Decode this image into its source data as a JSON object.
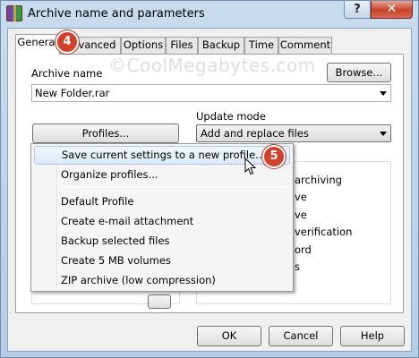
{
  "window": {
    "title": "Archive name and parameters",
    "help_label": "?",
    "close_label": "✕"
  },
  "tabs": [
    {
      "label": "General"
    },
    {
      "label": "Advanced"
    },
    {
      "label": "Options"
    },
    {
      "label": "Files"
    },
    {
      "label": "Backup"
    },
    {
      "label": "Time"
    },
    {
      "label": "Comment"
    }
  ],
  "general": {
    "archive_name_label": "Archive name",
    "archive_name_value": "New Folder.rar",
    "browse_label": "Browse...",
    "profiles_label": "Profiles...",
    "update_mode_label": "Update mode",
    "update_mode_value": "Add and replace files",
    "options_partial": [
      "archiving",
      "ve",
      "ve",
      "verification",
      "ord",
      "s"
    ]
  },
  "menu": {
    "items": [
      {
        "label": "Save current settings to a new profile..."
      },
      {
        "label": "Organize profiles..."
      },
      {
        "label": "Default Profile"
      },
      {
        "label": "Create e-mail attachment"
      },
      {
        "label": "Backup selected files"
      },
      {
        "label": "Create 5 MB volumes"
      },
      {
        "label": "ZIP archive (low compression)"
      }
    ]
  },
  "footer": {
    "ok_label": "OK",
    "cancel_label": "Cancel",
    "help_label": "Help"
  },
  "badges": {
    "step4": "4",
    "step5": "5"
  },
  "watermark": "©CoolMegabytes.com",
  "colors": {
    "badge": "#d2412c",
    "close": "#c7432a",
    "highlight": "#dde9f7"
  }
}
